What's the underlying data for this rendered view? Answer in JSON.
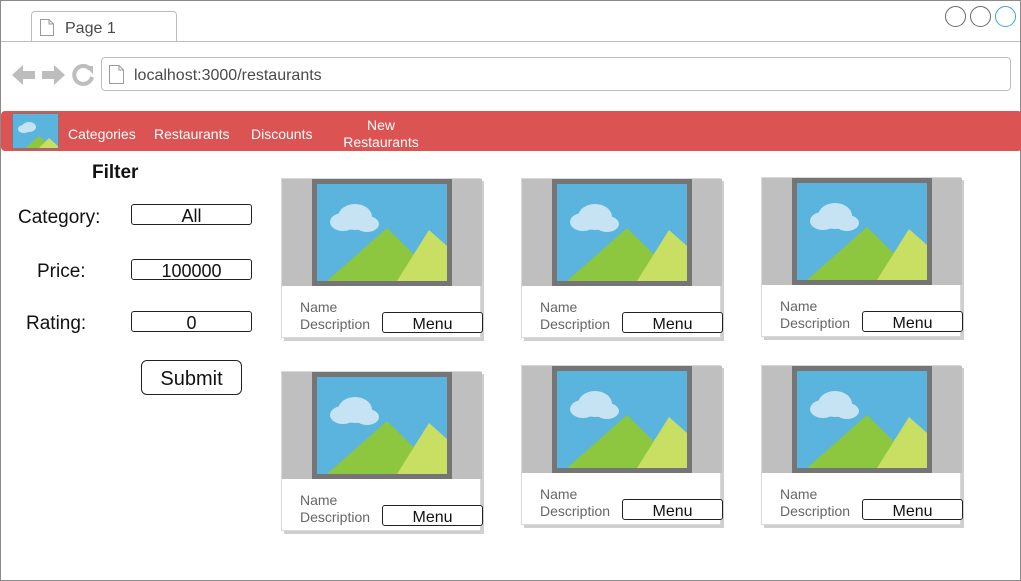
{
  "browser": {
    "tab_title": "Page 1",
    "url": "localhost:3000/restaurants"
  },
  "navbar": {
    "items": [
      "Categories",
      "Restaurants",
      "Discounts",
      "New Restaurants"
    ],
    "color": "#db5352"
  },
  "filter": {
    "title": "Filter",
    "category_label": "Category:",
    "category_value": "All",
    "price_label": "Price:",
    "price_value": "100000",
    "rating_label": "Rating:",
    "rating_value": "0",
    "submit_label": "Submit"
  },
  "restaurants": [
    {
      "name": "Name",
      "description": "Description",
      "menu_label": "Menu"
    },
    {
      "name": "Name",
      "description": "Description",
      "menu_label": "Menu"
    },
    {
      "name": "Name",
      "description": "Description",
      "menu_label": "Menu"
    },
    {
      "name": "Name",
      "description": "Description",
      "menu_label": "Menu"
    },
    {
      "name": "Name",
      "description": "Description",
      "menu_label": "Menu"
    },
    {
      "name": "Name",
      "description": "Description",
      "menu_label": "Menu"
    }
  ],
  "icons": {
    "tab": "page-icon",
    "back": "back-arrow-icon",
    "forward": "forward-arrow-icon",
    "reload": "reload-icon",
    "url": "page-icon",
    "logo": "image-placeholder-icon",
    "card_image": "image-placeholder-icon"
  }
}
